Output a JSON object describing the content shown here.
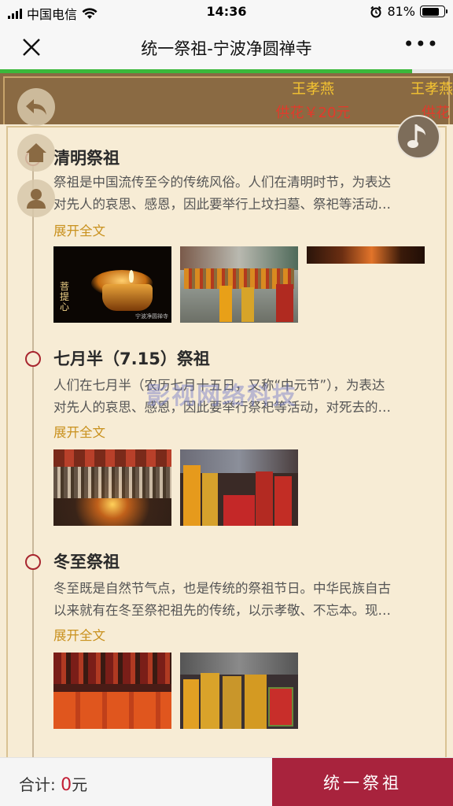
{
  "status_bar": {
    "carrier": "中国电信",
    "time": "14:36",
    "battery": "81%",
    "battery_level": 0.81
  },
  "nav": {
    "title": "统一祭祖-宁波净圆禅寺",
    "close_icon": "close-icon",
    "more_icon": "more-dots-icon"
  },
  "page_load_progress": 0.91,
  "donors": [
    {
      "name": "王孝燕",
      "gift": "供花￥20元"
    },
    {
      "name": "王孝燕",
      "gift": "供花"
    }
  ],
  "sections": [
    {
      "title": "清明祭祖",
      "desc_line1": "祭祖是中国流传至今的传统风俗。人们在清明时节，为表达",
      "desc_line2": "对先人的哀思、感恩，因此要举行上坟扫墓、祭祀等活动…",
      "expand": "展开全文",
      "photo_caption": "菩提心",
      "photo_wm": "宁波净圆禅寺"
    },
    {
      "title": "七月半（7.15）祭祖",
      "desc_line1": "人们在七月半（农历七月十五日，又称“中元节”），为表达",
      "desc_line2": "对先人的哀思、感恩，因此要举行祭祀等活动，对死去的…",
      "expand": "展开全文"
    },
    {
      "title": "冬至祭祖",
      "desc_line1": "冬至既是自然节气点，也是传统的祭祖节日。中华民族自古",
      "desc_line2": "以来就有在冬至祭祀祖先的传统，以示孝敬、不忘本。现…",
      "expand": "展开全文"
    }
  ],
  "watermark": "影视网络科技",
  "footer": {
    "total_label": "合计:",
    "total_amount": "0",
    "total_unit": "元",
    "submit_label": "统一祭祖"
  },
  "colors": {
    "accent": "#a8233d",
    "gold": "#c9911e",
    "banner": "#8a6a43",
    "progress": "#3bb83b"
  }
}
